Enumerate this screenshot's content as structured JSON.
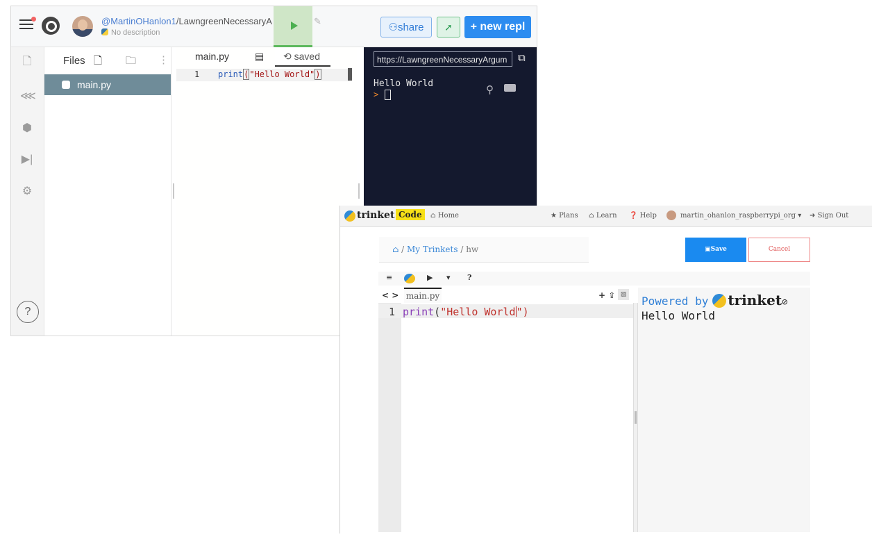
{
  "replit": {
    "user": "@MartinOHanlon1",
    "repl_name": "/LawngreenNecessaryA",
    "description": "No description",
    "share_label": "share",
    "new_repl_label": "+ new repl",
    "files_title": "Files",
    "file_name": "main.py",
    "help_glyph": "?",
    "editor": {
      "tab": "main.py",
      "saved_label": "saved",
      "line_number": "1",
      "code_fn": "print",
      "code_open": "(",
      "code_str": "\"Hello World\"",
      "code_close": ")"
    },
    "console": {
      "url": "https://LawngreenNecessaryArgum",
      "output": "Hello World",
      "prompt": ">"
    },
    "icons": [
      "menu-icon",
      "replit-logo-icon",
      "python-icon",
      "run-icon",
      "pencil-icon",
      "share-icon",
      "rocket-icon",
      "file-icon",
      "share-nodes-icon",
      "package-icon",
      "debugger-icon",
      "settings-icon",
      "add-file-icon",
      "add-folder-icon",
      "kebab-icon",
      "external-link-icon",
      "search-icon",
      "clear-icon"
    ]
  },
  "trinket": {
    "brand": "trinket",
    "code_badge": "Code",
    "nav": {
      "home": "Home",
      "plans": "Plans",
      "learn": "Learn",
      "help": "Help",
      "user": "martin_ohanlon_raspberrypi_org",
      "signout": "Sign Out"
    },
    "breadcrumb": {
      "my_trinkets": "My Trinkets",
      "separator": "/",
      "current": "hw"
    },
    "save_label": "Save",
    "cancel_label": "Cancel",
    "toolbar_help": "?",
    "file_tab": "main.py",
    "line_number": "1",
    "code_fn": "print",
    "code_open": "(",
    "code_str": "\"Hello World",
    "code_close": "\")",
    "powered_by": "Powered by",
    "output": "Hello World"
  }
}
